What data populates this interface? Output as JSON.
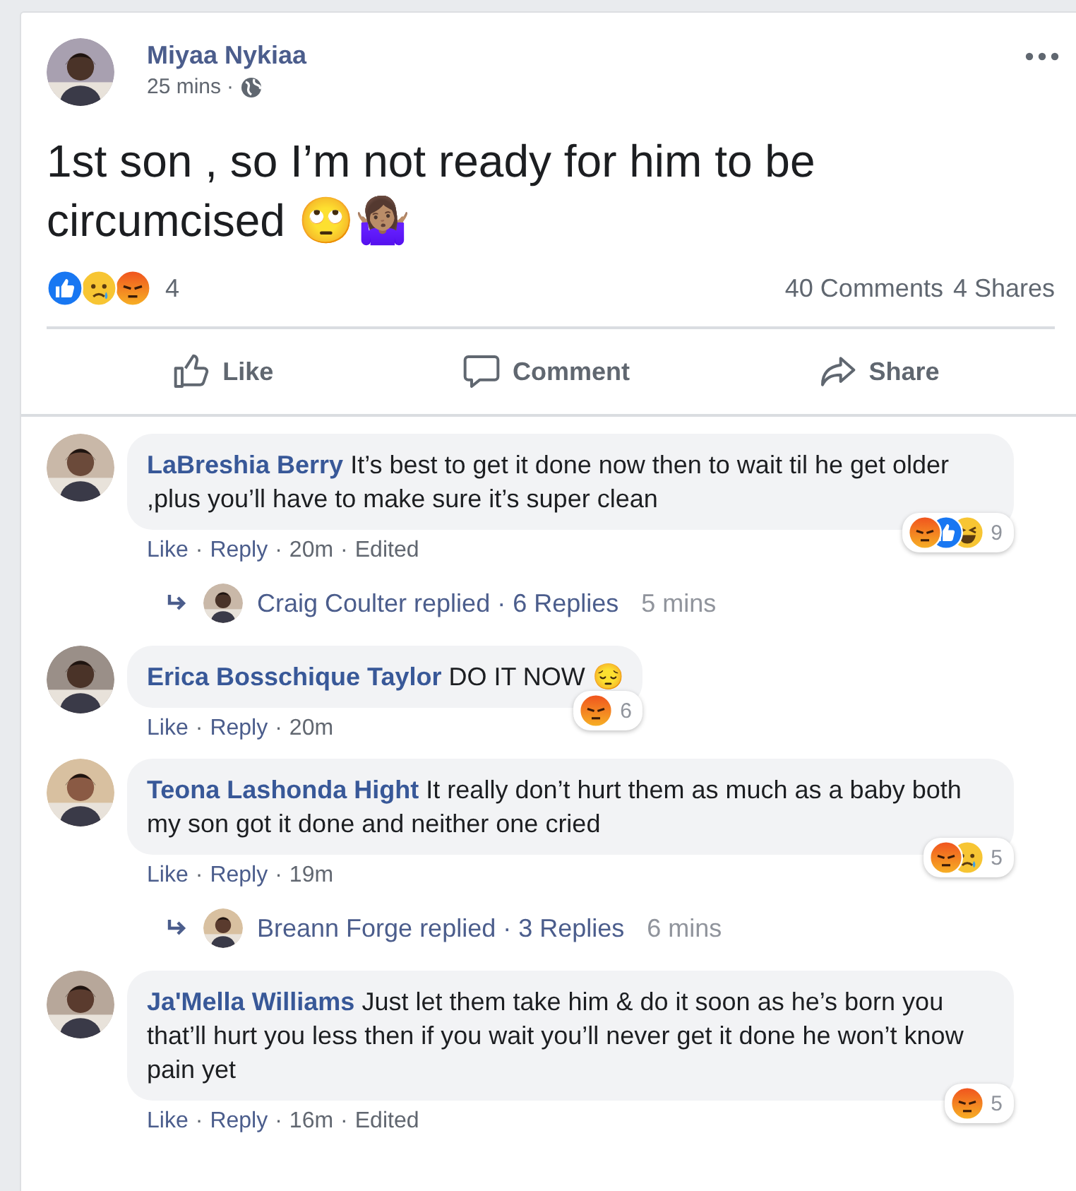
{
  "post": {
    "author": "Miyaa Nykiaa",
    "time": "25 mins",
    "separator": "·",
    "text": "1st son , so I’m not ready for him to be circumcised 🙄🤷🏽‍♀️",
    "reactions": [
      {
        "kind": "like"
      },
      {
        "kind": "sad"
      },
      {
        "kind": "angry"
      }
    ],
    "reaction_count": "4",
    "comments_count": "40 Comments",
    "shares_count": "4 Shares",
    "actions": [
      {
        "kind": "like",
        "label": "Like"
      },
      {
        "kind": "comment",
        "label": "Comment"
      },
      {
        "kind": "share",
        "label": "Share"
      }
    ]
  },
  "comments": [
    {
      "author": "LaBreshia Berry",
      "text": "It’s best to get it done now then to wait til he get older ,plus you’ll have to make sure it’s super clean",
      "like": "Like",
      "reply": "Reply",
      "time": "20m",
      "edited": "Edited",
      "reactions": [
        {
          "kind": "angry"
        },
        {
          "kind": "like"
        },
        {
          "kind": "haha"
        }
      ],
      "reaction_count": "9",
      "replies": {
        "who": "Craig Coulter replied",
        "count": "6 Replies",
        "time": "5 mins"
      }
    },
    {
      "author": "Erica Bosschique Taylor",
      "text": "DO IT NOW 😔",
      "like": "Like",
      "reply": "Reply",
      "time": "20m",
      "reactions": [
        {
          "kind": "angry"
        }
      ],
      "reaction_count": "6"
    },
    {
      "author": "Teona Lashonda Hight",
      "text": "It really don’t hurt them as much as a baby both my son got it done and neither one cried",
      "like": "Like",
      "reply": "Reply",
      "time": "19m",
      "reactions": [
        {
          "kind": "angry"
        },
        {
          "kind": "sad"
        }
      ],
      "reaction_count": "5",
      "replies": {
        "who": "Breann Forge replied",
        "count": "3 Replies",
        "time": "6 mins"
      }
    },
    {
      "author": "Ja'Mella Williams",
      "text": "Just let them take him & do it soon as he’s born you that’ll hurt you less then if you wait you’ll never get it done he won’t know pain yet",
      "like": "Like",
      "reply": "Reply",
      "time": "16m",
      "edited": "Edited",
      "reactions": [
        {
          "kind": "angry"
        }
      ],
      "reaction_count": "5"
    }
  ]
}
